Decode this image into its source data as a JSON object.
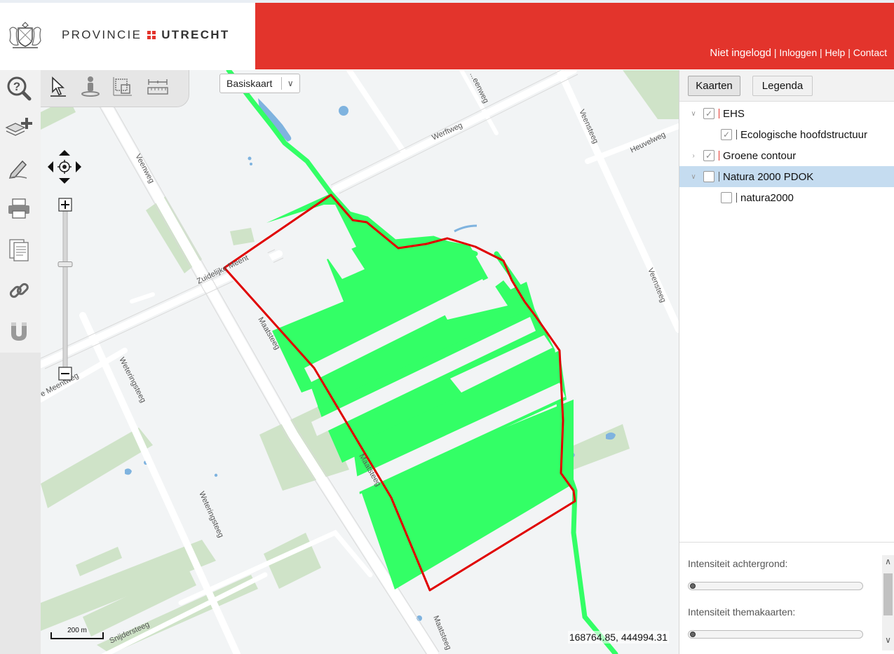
{
  "header": {
    "brand_light": "PROVINCIE",
    "brand_bold": "UTRECHT",
    "brand_color": "#e3342c",
    "login_status": "Niet ingelogd",
    "links": [
      "Inloggen",
      "Help",
      "Contact"
    ]
  },
  "toolbar": {
    "tools": [
      {
        "name": "info-icon"
      },
      {
        "name": "add-layer-icon"
      },
      {
        "name": "draw-icon"
      },
      {
        "name": "print-icon"
      },
      {
        "name": "document-icon"
      },
      {
        "name": "link-icon"
      },
      {
        "name": "magnet-icon"
      }
    ]
  },
  "map": {
    "basemap_select": "Basiskaart",
    "map_tools": [
      {
        "name": "select-arrow-icon"
      },
      {
        "name": "streetview-person-icon"
      },
      {
        "name": "measure-area-icon"
      },
      {
        "name": "measure-distance-icon"
      }
    ],
    "scale_label": "200 m",
    "coordinates": "168764.85, 444994.31",
    "zoom_level": 0.06,
    "street_labels": [
      "Veenweg",
      "Werftweg",
      "Veensteeg",
      "Heuvelweg",
      "Zuidelijke Meent",
      "Maatsteeg",
      "Weteringsteeg",
      "e Meentweg",
      "Snijdersteeg",
      "Maatsteeg",
      "Maatsteeg",
      "Weteringsteeg",
      "Veensteeg",
      "...eenweg"
    ],
    "colors": {
      "ehs_fill": "#33ff66",
      "selection_outline": "#e00000",
      "water": "#7fb3df",
      "park": "#cfe3c8",
      "road": "#ffffff"
    }
  },
  "panel": {
    "tabs": [
      "Kaarten",
      "Legenda"
    ],
    "active_tab": 0,
    "layers": [
      {
        "label": "EHS",
        "checked": true,
        "level": 0,
        "expanded": true
      },
      {
        "label": "Ecologische hoofdstructuur",
        "checked": true,
        "level": 1
      },
      {
        "label": "Groene contour",
        "checked": true,
        "level": 0,
        "expanded": false
      },
      {
        "label": "Natura 2000 PDOK",
        "checked": false,
        "level": 0,
        "expanded": true,
        "selected": true
      },
      {
        "label": "natura2000",
        "checked": false,
        "level": 1
      }
    ],
    "sliders": [
      {
        "label": "Intensiteit achtergrond:",
        "value": 0
      },
      {
        "label": "Intensiteit themakaarten:",
        "value": 0
      }
    ]
  }
}
